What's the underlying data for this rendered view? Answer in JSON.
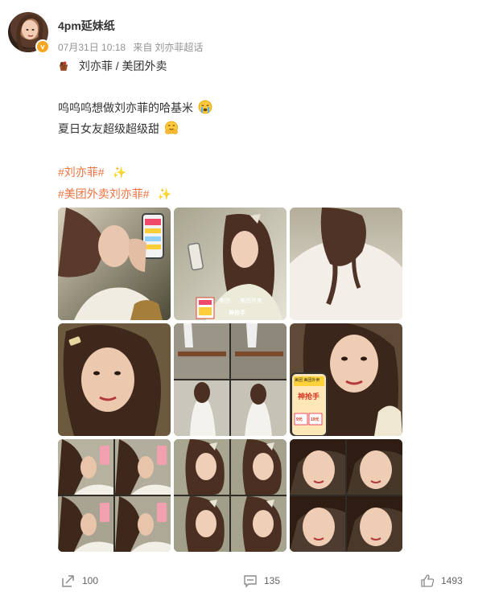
{
  "post": {
    "author": {
      "name": "4pm延妹纸",
      "verified_badge": "v"
    },
    "meta": {
      "date": "07月31日 10:18",
      "source_prefix": "来自",
      "source": "刘亦菲超话"
    },
    "topic_chip": {
      "icon": "cookie-basket-icon",
      "label": "刘亦菲 / 美团外卖"
    },
    "text_lines": [
      {
        "text": "呜呜呜想做刘亦菲的哈基米",
        "emoji": "crying-face-icon"
      },
      {
        "text": "夏日女友超级超级甜",
        "emoji": "smiling-hands-icon"
      }
    ],
    "hashtags": [
      {
        "text": "#刘亦菲#",
        "emoji": "sparkles-icon"
      },
      {
        "text": "#美团外卖刘亦菲#",
        "emoji": "sparkles-icon"
      }
    ],
    "images": {
      "count": 9,
      "tile_1": {
        "phone_brand": ""
      },
      "tile_2": {
        "sticker_left": "美团",
        "sticker_right": "美团外卖",
        "sticker_bottom": "神抢手"
      },
      "tile_6": {
        "phone_title": "美团 美团外卖",
        "phone_headline": "神抢手",
        "phone_tag_1": "9元",
        "phone_tag_2": "19元"
      }
    },
    "actions": {
      "repost": {
        "icon": "repost-icon",
        "count": "100"
      },
      "comment": {
        "icon": "comment-icon",
        "count": "135"
      },
      "like": {
        "icon": "thumbs-up-icon",
        "count": "1493"
      }
    },
    "colors": {
      "hashtag": "#eb7340",
      "text": "#333333",
      "meta": "#939393",
      "badge": "#f5a623"
    }
  }
}
